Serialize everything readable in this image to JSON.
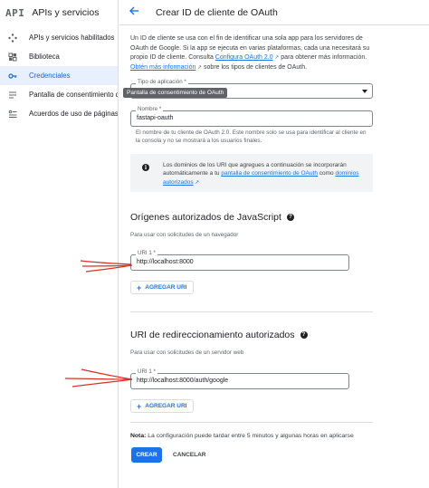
{
  "sidebar": {
    "logo": "API",
    "title": "APIs y servicios",
    "items": [
      {
        "label": "APIs y servicios habilitados",
        "icon": "diamond-nodes-icon",
        "active": false
      },
      {
        "label": "Biblioteca",
        "icon": "library-grid-icon",
        "active": false
      },
      {
        "label": "Credenciales",
        "icon": "key-icon",
        "active": true
      },
      {
        "label": "Pantalla de consentimiento de OAuth",
        "icon": "consent-list-icon",
        "active": false
      },
      {
        "label": "Acuerdos de uso de páginas",
        "icon": "settings-list-icon",
        "active": false
      }
    ]
  },
  "header": {
    "back_icon": "arrow-back-icon",
    "title": "Crear ID de cliente de OAuth"
  },
  "intro": {
    "p1": "Un ID de cliente se usa con el fin de identificar una sola app para los servidores de OAuth de Google. Si la app se ejecuta en varias plataformas, cada una necesitará su propio ID de cliente. Consulta",
    "link1": "Configura OAuth 2.0",
    "p2": "para obtener más información.",
    "link2": "Obtén más información",
    "p3": "sobre los tipos de clientes de OAuth."
  },
  "app_type": {
    "label": "Tipo de aplicación *",
    "tooltip": "Pantalla de consentimiento de OAuth"
  },
  "name_field": {
    "label": "Nombre *",
    "value": "fastapi-oauth",
    "helper": "El nombre de tu cliente de OAuth 2.0. Este nombre solo se usa para identificar al cliente en la consola y no se mostrará a los usuarios finales."
  },
  "notice": {
    "t1": "Los dominios de los URI que agregues a continuación se incorporarán automáticamente a tu",
    "link1": "pantalla de consentimiento de OAuth",
    "t2": "como",
    "link2": "dominios autorizados"
  },
  "js_origins": {
    "title": "Orígenes autorizados de JavaScript",
    "subtitle": "Para usar con solicitudes de un navegador",
    "uri_label": "URI 1 *",
    "uri_value": "http://localhost:8000",
    "add_label": "AGREGAR URI"
  },
  "redirect_uris": {
    "title": "URI de redireccionamiento autorizados",
    "subtitle": "Para usar con solicitudes de un servidor web",
    "uri_label": "URI 1 *",
    "uri_value": "http://localhost:8000/auth/google",
    "add_label": "AGREGAR URI"
  },
  "footer": {
    "note_prefix": "Nota:",
    "note_text": "La configuración puede tardar entre 5 minutos y algunas horas en aplicarse",
    "create_label": "CREAR",
    "cancel_label": "CANCELAR"
  },
  "colors": {
    "accent": "#1a73e8",
    "active_bg": "#e8f0fe",
    "annotation": "#d93025"
  }
}
